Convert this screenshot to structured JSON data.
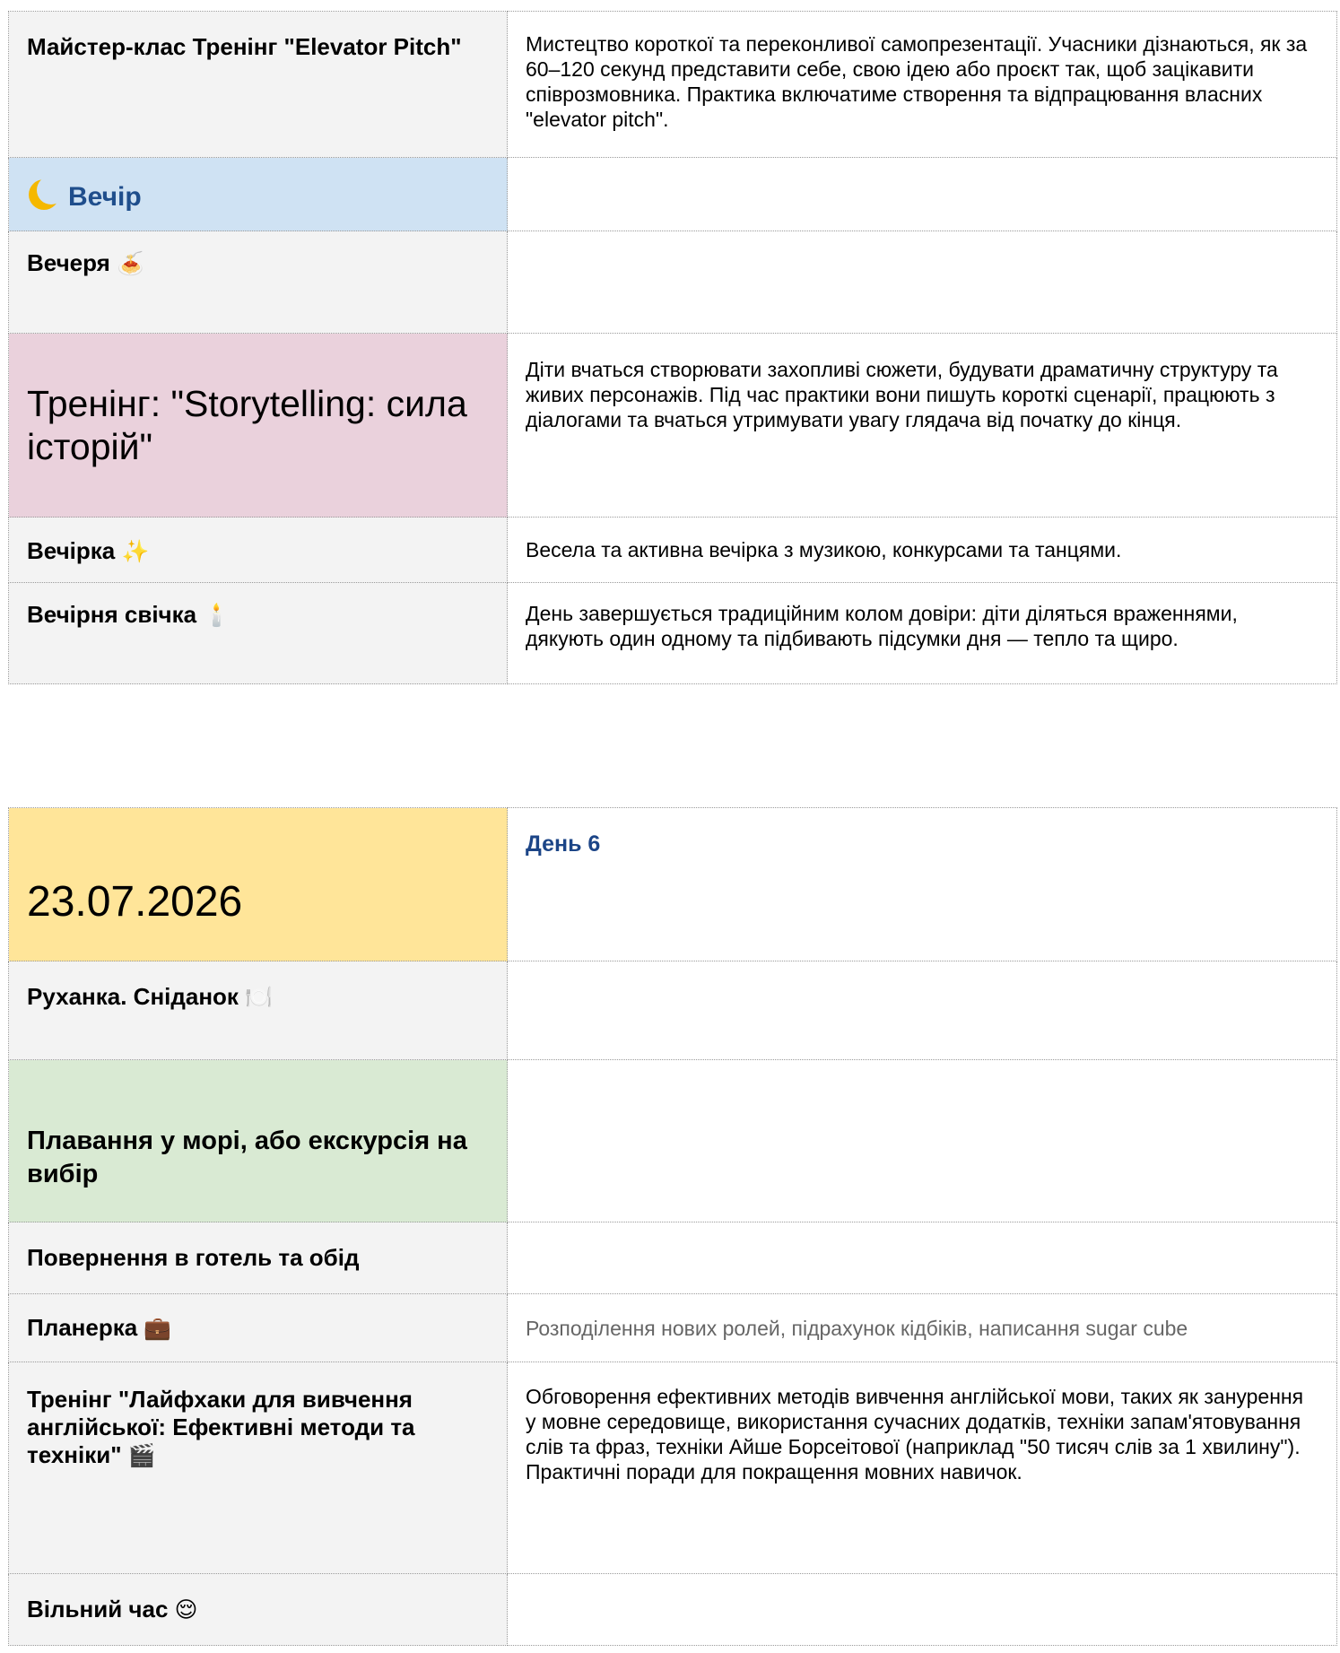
{
  "section1": {
    "rows": [
      {
        "title": "Майстер-клас Тренінг \"Elevator Pitch\"",
        "description": "Мистецтво короткої та переконливої самопрезентації. Учасники дізнаються, як за 60–120 секунд представити себе, свою ідею або проєкт так, щоб зацікавити співрозмовника. Практика включатиме створення та відпрацювання власних \"elevator pitch\"."
      },
      {
        "title": "Вечір",
        "icon": "crescent-moon-icon",
        "color": "#cfe2f3",
        "description": ""
      },
      {
        "title": "Вечеря",
        "emoji": "🍝",
        "icon": "spaghetti-icon",
        "description": ""
      },
      {
        "title": "Тренінг: \"Storytelling: сила історій\"",
        "color": "#ead1dc",
        "description": "Діти вчаться створювати захопливі сюжети, будувати драматичну структуру та живих персонажів. Під час практики вони пишуть короткі сценарії, працюють з діалогами та вчаться утримувати увагу глядача від початку до кінця."
      },
      {
        "title": "Вечірка",
        "emoji": "✨",
        "icon": "sparkles-icon",
        "description": "Весела та активна вечірка з музикою, конкурсами та танцями."
      },
      {
        "title": "Вечірня свічка",
        "emoji": "🕯️",
        "icon": "candle-icon",
        "description": "День завершується традиційним колом довіри: діти діляться враженнями, дякують один одному та підбивають підсумки дня — тепло та щиро."
      }
    ]
  },
  "section2": {
    "date": "23.07.2026",
    "date_color": "#ffe599",
    "day_label": "День 6",
    "rows": [
      {
        "title": "Руханка. Сніданок",
        "emoji": "🍽️",
        "icon": "plate-cutlery-icon",
        "description": ""
      },
      {
        "title": "Плавання у морі, або екскурсія на вибір",
        "color": "#d9ead3",
        "description": ""
      },
      {
        "title": "Повернення в готель та обід",
        "description": ""
      },
      {
        "title": "Планерка",
        "emoji": "💼",
        "icon": "briefcase-icon",
        "description": "Розподілення нових ролей, підрахунок кідбіків, написання sugar cube"
      },
      {
        "title": "Тренінг \"Лайфхаки для вивчення англійської: Ефективні методи та техніки\"",
        "emoji": "🎬",
        "icon": "clapper-board-icon",
        "description": "Обговорення ефективних методів вивчення англійської мови, таких як занурення у мовне середовище, використання сучасних додатків, техніки запам'ятовування слів та фраз, техніки Айше Борсеітової (наприклад \"50 тисяч слів за 1 хвилину\"). Практичні поради для покращення мовних навичок."
      },
      {
        "title": "Вільний час",
        "emoji": "😌",
        "icon": "relieved-face-icon",
        "description": ""
      }
    ]
  }
}
